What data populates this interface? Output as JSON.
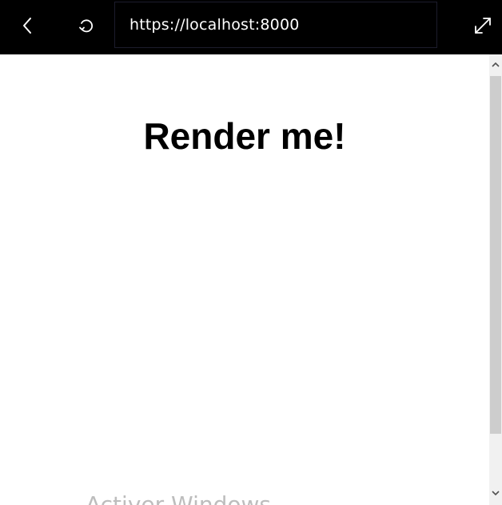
{
  "browser": {
    "url": "https://localhost:8000",
    "icons": {
      "back": "chevron-left-icon",
      "reload": "reload-icon",
      "expand": "expand-icon"
    }
  },
  "page": {
    "heading": "Render me!",
    "watermark": "Activer Windows"
  },
  "colors": {
    "toolbar_bg": "#000000",
    "page_bg": "#ffffff",
    "scrollbar_thumb": "#cdcdcd"
  }
}
